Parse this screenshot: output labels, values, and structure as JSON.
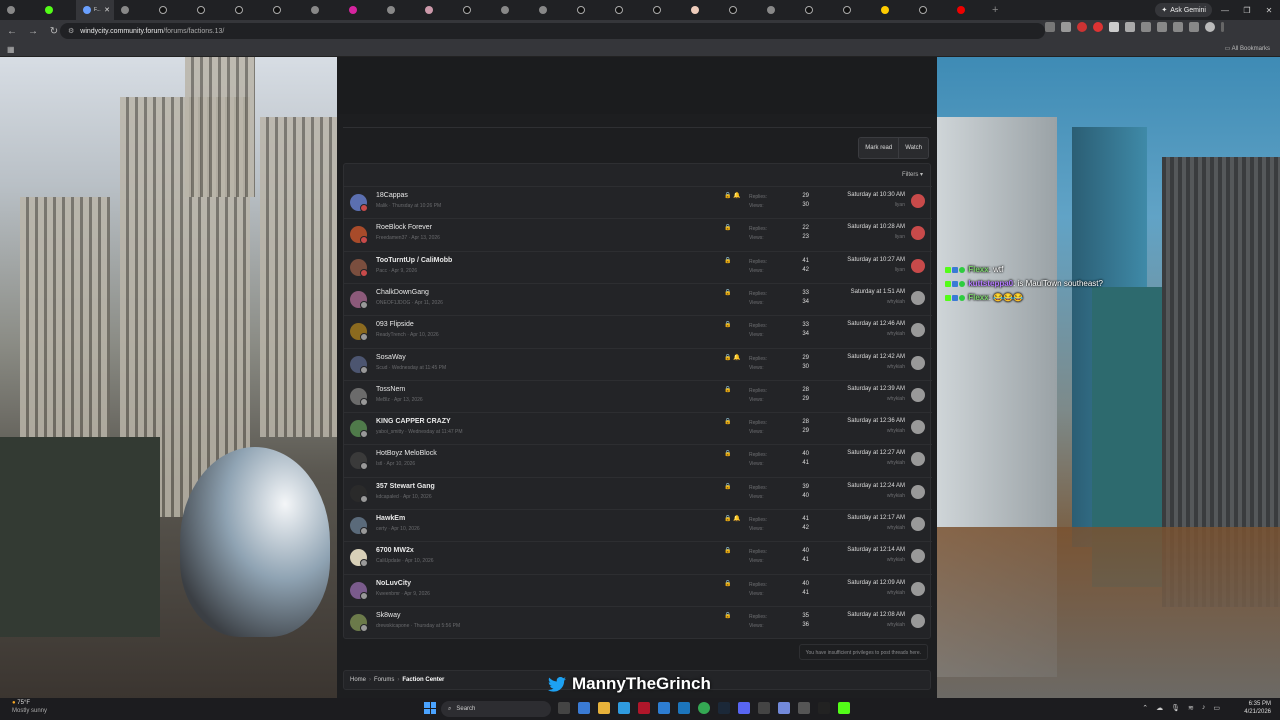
{
  "browser": {
    "active_tab_title": "F...",
    "url_host": "windycity.community.forum",
    "url_path": "/forums/factions.13/",
    "ask_gemini": "Ask Gemini",
    "all_bookmarks": "All Bookmarks"
  },
  "toolbar": {
    "mark_read": "Mark read",
    "watch": "Watch",
    "filters": "Filters ▾"
  },
  "stats": {
    "replies_label": "Replies:",
    "views_label": "Views:"
  },
  "threads": [
    {
      "title": "18Cappas",
      "bold": false,
      "meta": "Malik · Thursday at 10:26 PM",
      "replies": "29",
      "views": "30",
      "last_date": "Saturday at 10:30 AM",
      "last_user": "liyan",
      "lock": "🔒 🔔",
      "av": "#5b6fb0",
      "lav": "#c84a4a"
    },
    {
      "title": "RoeBlock Forever",
      "bold": false,
      "meta": "Freedamen37 · Apr 13, 2026",
      "replies": "22",
      "views": "23",
      "last_date": "Saturday at 10:28 AM",
      "last_user": "liyan",
      "lock": "🔒",
      "av": "#a84b2a",
      "lav": "#c84a4a"
    },
    {
      "title": "TooTurntUp / CaliMobb",
      "bold": true,
      "meta": "Pacc · Apr 9, 2026",
      "replies": "41",
      "views": "42",
      "last_date": "Saturday at 10:27 AM",
      "last_user": "liyan",
      "lock": "🔒",
      "av": "#7a4e3e",
      "lav": "#c84a4a"
    },
    {
      "title": "ChalkDownGang",
      "bold": false,
      "meta": "ONEOF1JDOG · Apr 11, 2026",
      "replies": "33",
      "views": "34",
      "last_date": "Saturday at 1:51 AM",
      "last_user": "whykiah",
      "lock": "🔒",
      "av": "#8c5a7a",
      "lav": "#999"
    },
    {
      "title": "093 Flipside",
      "bold": false,
      "meta": "ReadyTrench · Apr 10, 2026",
      "replies": "33",
      "views": "34",
      "last_date": "Saturday at 12:46 AM",
      "last_user": "whykiah",
      "lock": "🔒",
      "av": "#8b6a1f",
      "lav": "#999"
    },
    {
      "title": "SosaWay",
      "bold": false,
      "meta": "Scud · Wednesday at 11:45 PM",
      "replies": "29",
      "views": "30",
      "last_date": "Saturday at 12:42 AM",
      "last_user": "whykiah",
      "lock": "🔒 🔔",
      "av": "#4c5570",
      "lav": "#999"
    },
    {
      "title": "TossNem",
      "bold": false,
      "meta": "MeBlz · Apr 13, 2026",
      "replies": "28",
      "views": "29",
      "last_date": "Saturday at 12:39 AM",
      "last_user": "whykiah",
      "lock": "🔒",
      "av": "#6b6b6b",
      "lav": "#999"
    },
    {
      "title": "KING CAPPER CRAZY",
      "bold": true,
      "meta": "yaboi_smitty · Wednesday at 11:47 PM",
      "replies": "28",
      "views": "29",
      "last_date": "Saturday at 12:36 AM",
      "last_user": "whykiah",
      "lock": "🔒",
      "av": "#4f7a4a",
      "lav": "#999"
    },
    {
      "title": "HotBoyz MeloBlock",
      "bold": false,
      "meta": "Istl · Apr 10, 2026",
      "replies": "40",
      "views": "41",
      "last_date": "Saturday at 12:27 AM",
      "last_user": "whykiah",
      "lock": "🔒",
      "av": "#3a3a3a",
      "lav": "#999"
    },
    {
      "title": "357 Stewart Gang",
      "bold": true,
      "meta": "kdcapaled · Apr 10, 2026",
      "replies": "39",
      "views": "40",
      "last_date": "Saturday at 12:24 AM",
      "last_user": "whykiah",
      "lock": "🔒",
      "av": "#2a2a2a",
      "lav": "#999"
    },
    {
      "title": "HawkEm",
      "bold": true,
      "meta": "certy · Apr 10, 2026",
      "replies": "41",
      "views": "42",
      "last_date": "Saturday at 12:17 AM",
      "last_user": "whykiah",
      "lock": "🔒 🔔",
      "av": "#5a6a7a",
      "lav": "#999"
    },
    {
      "title": "6700 MW2x",
      "bold": true,
      "meta": "CaliUpdate · Apr 10, 2026",
      "replies": "40",
      "views": "41",
      "last_date": "Saturday at 12:14 AM",
      "last_user": "whykiah",
      "lock": "🔒",
      "av": "#d8d0b8",
      "lav": "#999"
    },
    {
      "title": "NoLuvCity",
      "bold": true,
      "meta": "Kweenbmr · Apr 9, 2026",
      "replies": "40",
      "views": "41",
      "last_date": "Saturday at 12:09 AM",
      "last_user": "whykiah",
      "lock": "🔒",
      "av": "#7a5b8c",
      "lav": "#999"
    },
    {
      "title": "Sk8way",
      "bold": false,
      "meta": "drewskicapone · Thursday at 5:56 PM",
      "replies": "35",
      "views": "36",
      "last_date": "Saturday at 12:08 AM",
      "last_user": "whykiah",
      "lock": "🔒",
      "av": "#6b7a4a",
      "lav": "#999"
    }
  ],
  "privilege_note": "You have insufficient privileges to post threads here.",
  "breadcrumb": [
    {
      "label": "Home"
    },
    {
      "label": "Forums"
    },
    {
      "label": "Faction Center"
    }
  ],
  "chat": [
    {
      "user": "Flexx",
      "color": "#7ad36a",
      "text": "wtf"
    },
    {
      "user": "kuttsteppa0",
      "color": "#b57bff",
      "text": "is MaulTown southeast?"
    },
    {
      "user": "Flexx",
      "color": "#7ad36a",
      "text": "😂😂😂"
    }
  ],
  "overlay": {
    "twitter_handle": "MannyTheGrinch"
  },
  "taskbar": {
    "temp": "75°F",
    "condition": "Mostly sunny",
    "search_label": "Search",
    "time": "6:35 PM",
    "date": "4/21/2026"
  }
}
